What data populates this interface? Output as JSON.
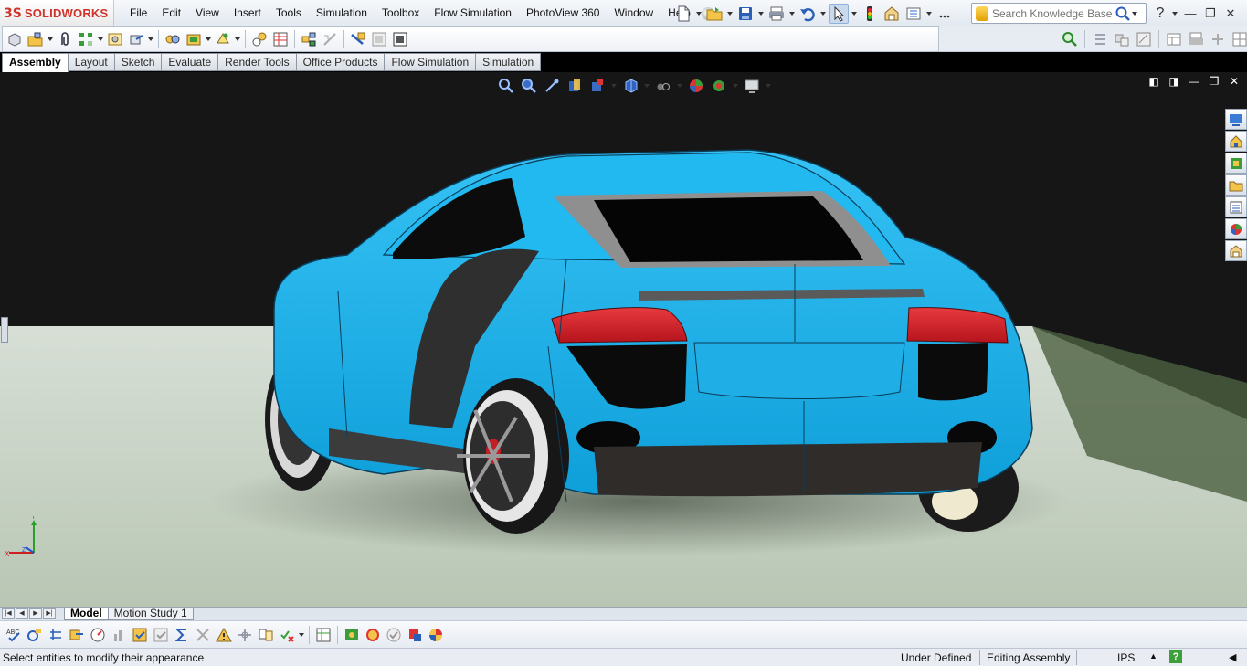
{
  "app": {
    "brand_prefix": "3S",
    "brand_name": "SOLIDWORKS"
  },
  "menu": [
    "File",
    "Edit",
    "View",
    "Insert",
    "Tools",
    "Simulation",
    "Toolbox",
    "Flow Simulation",
    "PhotoView 360",
    "Window",
    "Help"
  ],
  "search": {
    "placeholder": "Search Knowledge Base"
  },
  "help": {
    "question_mark": "?"
  },
  "window_controls": {
    "minimize": "—",
    "restore": "❐",
    "close": "✕"
  },
  "command_tabs": [
    "Assembly",
    "Layout",
    "Sketch",
    "Evaluate",
    "Render Tools",
    "Office Products",
    "Flow Simulation",
    "Simulation"
  ],
  "active_command_tab": "Assembly",
  "bottom_tabs": [
    "Model",
    "Motion Study 1"
  ],
  "active_bottom_tab": "Model",
  "triad": {
    "y": "Y",
    "x": "X",
    "z": "Z"
  },
  "status": {
    "message": "Select entities to modify their appearance",
    "definition": "Under Defined",
    "mode": "Editing Assembly",
    "units": "IPS",
    "help_label": "?"
  },
  "colors": {
    "car_body": "#16b3ee",
    "tail_light": "#d8202a",
    "background_dark": "#161616",
    "floor": "#c7d3c4",
    "accent": "#d0332b"
  }
}
